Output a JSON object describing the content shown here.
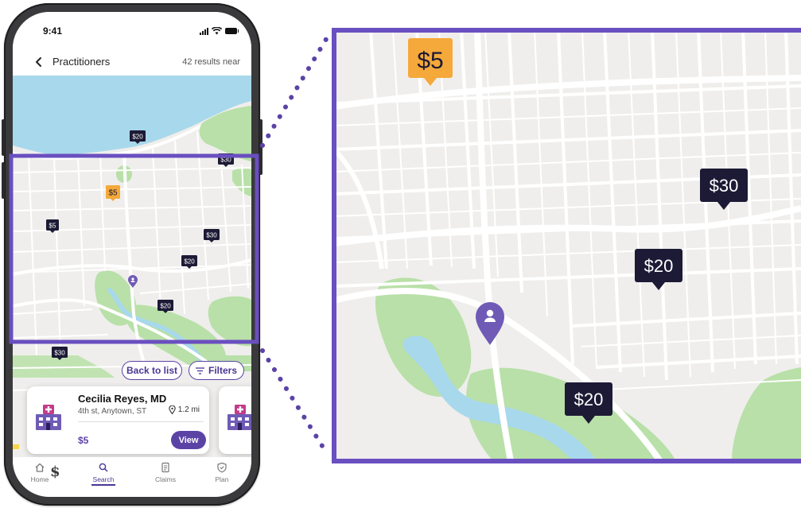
{
  "status_bar": {
    "time": "9:41"
  },
  "nav": {
    "title": "Practitioners",
    "results": "42 results near"
  },
  "map": {
    "price_markers": [
      {
        "label": "$20",
        "highlighted": false
      },
      {
        "label": "$30",
        "highlighted": false
      },
      {
        "label": "$5",
        "highlighted": true
      },
      {
        "label": "$5",
        "highlighted": false
      },
      {
        "label": "$30",
        "highlighted": false
      },
      {
        "label": "$20",
        "highlighted": false
      },
      {
        "label": "$20",
        "highlighted": false
      },
      {
        "label": "$30",
        "highlighted": false
      }
    ],
    "user_location_icon": "user-location-pin-icon"
  },
  "actions": {
    "back_to_list": "Back to list",
    "filters": "Filters"
  },
  "practitioner_card": {
    "name": "Cecilia Reyes, MD",
    "address": "4th st, Anytown, ST",
    "distance": "1.2 mi",
    "price": "$5",
    "view_label": "View"
  },
  "tabs": [
    {
      "label": "Home",
      "icon": "home-icon",
      "active": false
    },
    {
      "label": "Search",
      "icon": "search-icon",
      "active": true
    },
    {
      "label": "Claims",
      "icon": "document-icon",
      "active": false
    },
    {
      "label": "Plan",
      "icon": "shield-icon",
      "active": false
    }
  ],
  "zoom_map": {
    "price_markers": [
      {
        "label": "$5",
        "highlighted": true
      },
      {
        "label": "$30",
        "highlighted": false
      },
      {
        "label": "$20",
        "highlighted": false
      },
      {
        "label": "$20",
        "highlighted": false
      }
    ]
  },
  "colors": {
    "accent": "#5b43a6",
    "highlight_marker": "#f5a93a",
    "marker": "#1c1a35",
    "water": "#a8d8ec",
    "park": "#b8e0a8",
    "land": "#efeeec",
    "road": "#ffffff"
  }
}
